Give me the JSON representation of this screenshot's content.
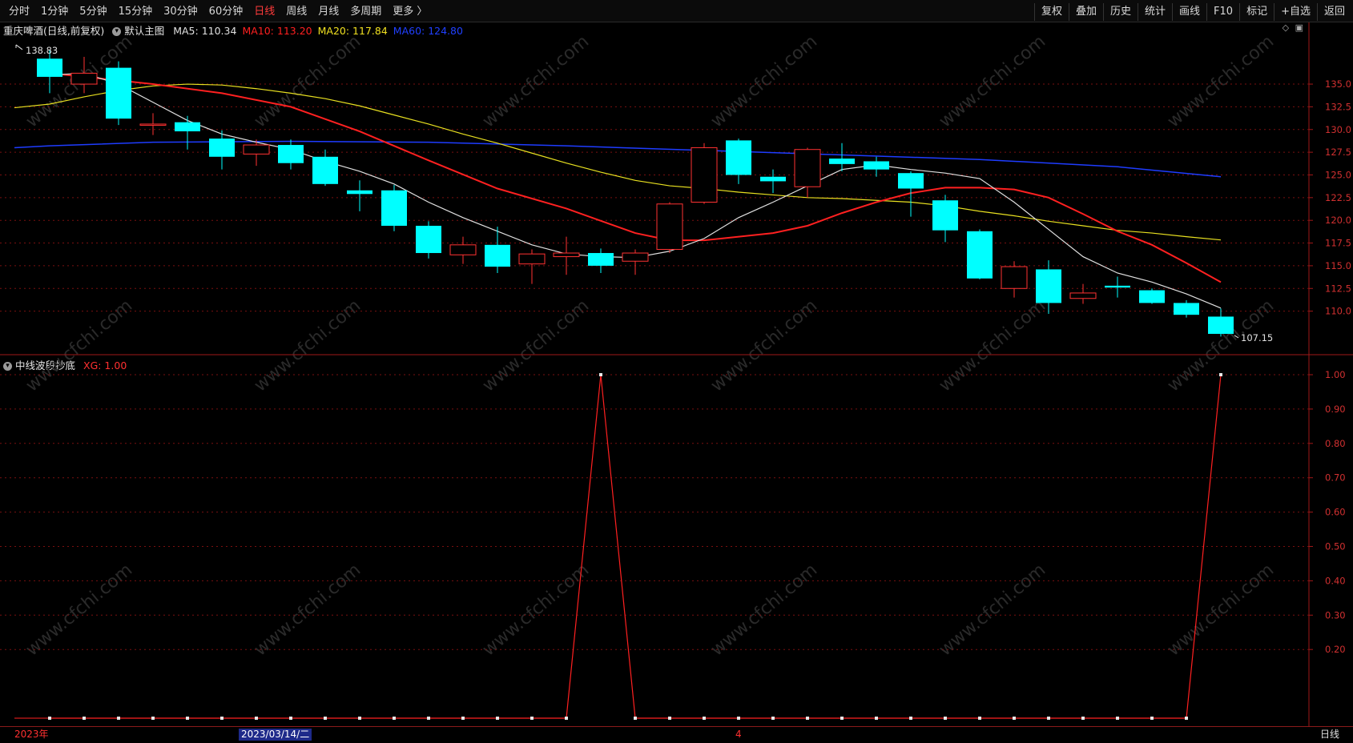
{
  "toolbar": {
    "left_items": [
      "分时",
      "1分钟",
      "5分钟",
      "15分钟",
      "30分钟",
      "60分钟",
      "日线",
      "周线",
      "月线",
      "多周期",
      "更多 〉"
    ],
    "active_index": 6,
    "right_items": [
      "复权",
      "叠加",
      "历史",
      "统计",
      "画线",
      "F10",
      "标记",
      "+自选",
      "返回"
    ]
  },
  "main_chart": {
    "title": "重庆啤酒(日线,前复权)",
    "template_label": "默认主图",
    "ma_labels": [
      {
        "text": "MA5: 110.34",
        "color": "#e0e0e0"
      },
      {
        "text": "MA10: 113.20",
        "color": "#ff2020"
      },
      {
        "text": "MA20: 117.84",
        "color": "#f0e020"
      },
      {
        "text": "MA60: 124.80",
        "color": "#2040ff"
      }
    ],
    "high_label": "138.83",
    "low_label": "107.15",
    "y_ticks": [
      "135.0",
      "132.5",
      "130.0",
      "127.5",
      "125.0",
      "122.5",
      "120.0",
      "117.5",
      "115.0",
      "112.5",
      "110.0"
    ]
  },
  "sub_chart": {
    "title": "中线波段抄底",
    "value_label": "XG: 1.00",
    "y_ticks": [
      "1.00",
      "0.90",
      "0.80",
      "0.70",
      "0.60",
      "0.50",
      "0.40",
      "0.30",
      "0.20"
    ]
  },
  "bottom_bar": {
    "year_label": "2023年",
    "date_label": "2023/03/14/二",
    "month_label": "4",
    "period_label": "日线"
  },
  "watermark": "www.cfchi.com",
  "colors": {
    "up": "#ff3232",
    "down": "#00ffff",
    "ma5": "#e0e0e0",
    "ma10": "#ff2020",
    "ma20": "#e8e020",
    "ma60": "#1e3cff",
    "grid": "#7a1010",
    "indicator": "#ff2020"
  },
  "chart_data": {
    "type": "candlestick",
    "ylim": [
      106,
      139.5
    ],
    "candles": [
      {
        "o": 137.8,
        "h": 138.8,
        "l": 134.0,
        "c": 135.8
      },
      {
        "o": 135.0,
        "h": 138.0,
        "l": 134.0,
        "c": 136.2
      },
      {
        "o": 136.8,
        "h": 137.5,
        "l": 130.5,
        "c": 131.2
      },
      {
        "o": 130.6,
        "h": 131.8,
        "l": 129.4,
        "c": 130.6
      },
      {
        "o": 130.8,
        "h": 131.5,
        "l": 127.8,
        "c": 129.8
      },
      {
        "o": 129.0,
        "h": 129.9,
        "l": 125.6,
        "c": 127.0
      },
      {
        "o": 127.3,
        "h": 128.9,
        "l": 126.0,
        "c": 128.3
      },
      {
        "o": 128.3,
        "h": 128.9,
        "l": 125.6,
        "c": 126.3
      },
      {
        "o": 127.0,
        "h": 127.8,
        "l": 123.8,
        "c": 124.0
      },
      {
        "o": 123.3,
        "h": 124.4,
        "l": 121.0,
        "c": 122.9
      },
      {
        "o": 123.3,
        "h": 123.9,
        "l": 118.8,
        "c": 119.4
      },
      {
        "o": 119.4,
        "h": 119.9,
        "l": 115.8,
        "c": 116.4
      },
      {
        "o": 116.2,
        "h": 118.2,
        "l": 115.2,
        "c": 117.3
      },
      {
        "o": 117.3,
        "h": 119.3,
        "l": 114.2,
        "c": 114.9
      },
      {
        "o": 115.2,
        "h": 116.8,
        "l": 113.0,
        "c": 116.3
      },
      {
        "o": 116.0,
        "h": 118.2,
        "l": 114.0,
        "c": 116.4
      },
      {
        "o": 116.4,
        "h": 116.9,
        "l": 114.2,
        "c": 115.0
      },
      {
        "o": 115.5,
        "h": 116.8,
        "l": 114.0,
        "c": 116.4
      },
      {
        "o": 116.8,
        "h": 122.0,
        "l": 116.4,
        "c": 121.8
      },
      {
        "o": 122.0,
        "h": 128.5,
        "l": 121.8,
        "c": 128.0
      },
      {
        "o": 128.8,
        "h": 129.0,
        "l": 124.0,
        "c": 125.0
      },
      {
        "o": 124.8,
        "h": 125.6,
        "l": 123.0,
        "c": 124.3
      },
      {
        "o": 123.7,
        "h": 128.0,
        "l": 122.5,
        "c": 127.8
      },
      {
        "o": 126.8,
        "h": 128.5,
        "l": 125.4,
        "c": 126.2
      },
      {
        "o": 126.5,
        "h": 127.0,
        "l": 124.8,
        "c": 125.6
      },
      {
        "o": 125.2,
        "h": 125.4,
        "l": 120.4,
        "c": 123.5
      },
      {
        "o": 122.2,
        "h": 122.8,
        "l": 117.6,
        "c": 118.9
      },
      {
        "o": 118.8,
        "h": 119.0,
        "l": 113.5,
        "c": 113.6
      },
      {
        "o": 112.5,
        "h": 115.5,
        "l": 111.5,
        "c": 114.9
      },
      {
        "o": 114.6,
        "h": 115.6,
        "l": 109.7,
        "c": 110.9
      },
      {
        "o": 111.4,
        "h": 113.0,
        "l": 110.8,
        "c": 112.0
      },
      {
        "o": 112.8,
        "h": 113.8,
        "l": 111.5,
        "c": 112.6
      },
      {
        "o": 112.3,
        "h": 112.5,
        "l": 110.8,
        "c": 110.9
      },
      {
        "o": 110.9,
        "h": 111.2,
        "l": 109.3,
        "c": 109.6
      },
      {
        "o": 109.4,
        "h": 110.3,
        "l": 107.2,
        "c": 107.5
      }
    ],
    "ma5": [
      136.0,
      136.2,
      135.0,
      133.0,
      131.0,
      129.5,
      128.6,
      127.8,
      126.5,
      125.4,
      124.0,
      122.0,
      120.3,
      118.8,
      117.3,
      116.3,
      116.0,
      115.9,
      116.6,
      118.0,
      120.3,
      122.0,
      123.8,
      125.6,
      126.1,
      125.6,
      125.2,
      124.6,
      122.0,
      119.0,
      116.0,
      114.2,
      113.2,
      111.9,
      110.34
    ],
    "ma20": [
      132.8,
      133.6,
      134.3,
      134.8,
      135.0,
      134.9,
      134.5,
      134.0,
      133.4,
      132.6,
      131.6,
      130.6,
      129.5,
      128.5,
      127.4,
      126.3,
      125.3,
      124.4,
      123.8,
      123.5,
      123.1,
      122.8,
      122.5,
      122.4,
      122.2,
      122.0,
      121.6,
      121.0,
      120.5,
      119.9,
      119.4,
      118.9,
      118.6,
      118.2,
      117.84
    ],
    "ma10_points": [
      [
        0,
        136.2
      ],
      [
        3,
        135.0
      ],
      [
        5,
        134.0
      ],
      [
        7,
        132.5
      ],
      [
        9,
        129.8
      ],
      [
        11,
        126.6
      ],
      [
        13,
        123.5
      ],
      [
        15,
        121.3
      ],
      [
        17,
        118.6
      ],
      [
        18,
        117.8
      ],
      [
        19,
        117.8
      ],
      [
        21,
        118.6
      ],
      [
        22,
        119.4
      ],
      [
        23,
        120.8
      ],
      [
        24,
        122.0
      ],
      [
        25,
        123.0
      ],
      [
        26,
        123.6
      ],
      [
        27,
        123.6
      ],
      [
        28,
        123.4
      ],
      [
        29,
        122.5
      ],
      [
        30,
        120.7
      ],
      [
        31,
        118.8
      ],
      [
        32,
        117.3
      ],
      [
        33,
        115.3
      ],
      [
        34,
        113.2
      ]
    ],
    "ma60_points": [
      [
        0,
        128.2
      ],
      [
        3,
        128.6
      ],
      [
        7,
        128.7
      ],
      [
        11,
        128.6
      ],
      [
        15,
        128.2
      ],
      [
        19,
        127.7
      ],
      [
        23,
        127.2
      ],
      [
        27,
        126.7
      ],
      [
        31,
        125.9
      ],
      [
        34,
        124.8
      ]
    ],
    "xg": [
      0,
      0,
      0,
      0,
      0,
      0,
      0,
      0,
      0,
      0,
      0,
      0,
      0,
      0,
      0,
      0,
      1,
      0,
      0,
      0,
      0,
      0,
      0,
      0,
      0,
      0,
      0,
      0,
      0,
      0,
      0,
      0,
      0,
      0,
      1
    ]
  }
}
